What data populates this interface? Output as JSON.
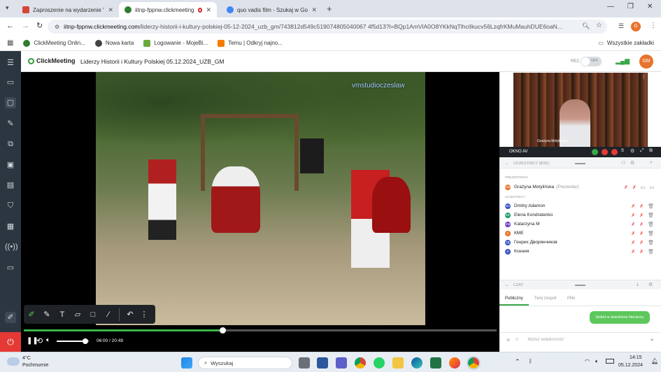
{
  "browser": {
    "tabs": [
      {
        "label": "Zaproszenie na wydarzenie \"Lid",
        "icon": "gmail-icon",
        "color": "#d44638"
      },
      {
        "label": "iitnp-fppnw.clickmeeting.c",
        "icon": "clickmeeting-icon",
        "color": "#2e7d32"
      },
      {
        "label": "quo vadis film - Szukaj w Goog",
        "icon": "google-icon",
        "color": "#4285f4"
      }
    ],
    "url_host": "iitnp-fppnw.clickmeeting.com",
    "url_path": "/liderzy-historii-i-kultury-polskiej-05-12-2024_uzb_gm/743812d549c519074805040067 4f5d13?l=BQp1AmVlA0O8YKkNqTlhciIkucv56LzqfrKMuMauhDUE6oaN...",
    "profile_initial": "G",
    "bookmarks": [
      "ClickMeeting Onlin...",
      "Nowa karta",
      "Logowanie - MojeBi...",
      "Temu | Odkryj najno..."
    ],
    "all_bookmarks": "Wszystkie zakładki"
  },
  "app": {
    "logo": "ClickMeeting",
    "title": "Liderzy Historii i Kultury Polskiej 05.12.2024_UZB_GM",
    "rec_label": "REC",
    "rec_toggle": "OFF",
    "user_initials": "GM"
  },
  "video": {
    "watermark": "vmstudioczeslaw",
    "time": "06:00 / 20:49",
    "progress": 0.42,
    "volume": 0.9
  },
  "panel": {
    "presenter_name": "Grażyna Motylińska",
    "av_label": "OKNO AV",
    "participants_header": "UCZESTNICY (8/25)",
    "presenters_label": "PREZENTERZY",
    "participants_label": "UCZESTNICY",
    "presenter": {
      "name": "Grażyna Motylińska",
      "role": "(Prezenter)",
      "initials": "GM",
      "color": "#e8732c"
    },
    "participants": [
      {
        "name": "Dmitry Adamon",
        "initials": "DA",
        "color": "#3a55c4"
      },
      {
        "name": "Elena Kondratenko",
        "initials": "EK",
        "color": "#1a9e6a"
      },
      {
        "name": "Katarzyna M",
        "initials": "KM",
        "color": "#6a3ac4"
      },
      {
        "name": "КМЕ",
        "initials": "K",
        "color": "#e8732c"
      },
      {
        "name": "Генрих Дворянчиков",
        "initials": "ГД",
        "color": "#3a55c4"
      },
      {
        "name": "Ксения",
        "initials": "K",
        "color": "#3a55c4"
      }
    ],
    "chat_header": "CZAT",
    "chat_tabs": [
      "Publiczny",
      "Twój zespół",
      "Pliki"
    ],
    "chat_message": "Nobel w dziedzinie literatury",
    "chat_placeholder": "Wpisz wiadomość"
  },
  "taskbar": {
    "weather_temp": "4°C",
    "weather_desc": "Pochmurnie",
    "search": "Wyszukaj",
    "time": "14:15",
    "date": "05.12.2024"
  }
}
